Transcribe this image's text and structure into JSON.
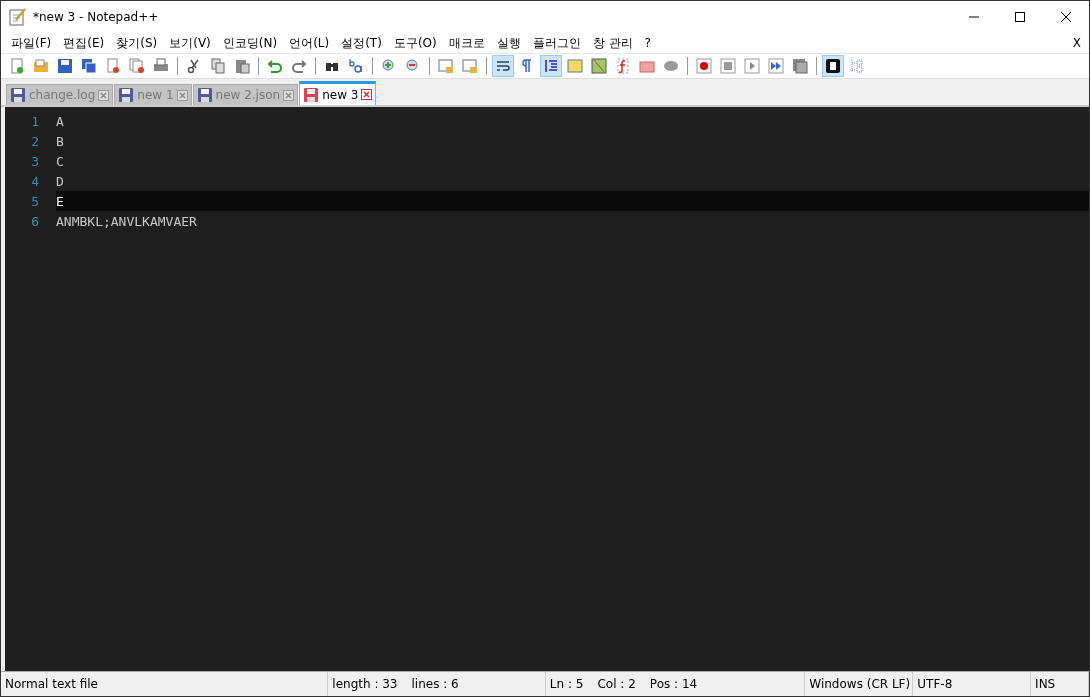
{
  "window": {
    "title": "*new 3 - Notepad++"
  },
  "menu": {
    "items": [
      "파일(F)",
      "편집(E)",
      "찾기(S)",
      "보기(V)",
      "인코딩(N)",
      "언어(L)",
      "설정(T)",
      "도구(O)",
      "매크로",
      "실행",
      "플러그인",
      "창 관리",
      "?"
    ],
    "close_label": "X"
  },
  "toolbar": {
    "groups": [
      [
        {
          "pressed": false
        },
        {
          "pressed": false
        },
        {
          "pressed": false
        },
        {
          "pressed": false
        },
        {
          "pressed": false
        },
        {
          "pressed": false
        },
        {
          "pressed": false
        }
      ],
      [
        {
          "pressed": false
        },
        {
          "pressed": false
        },
        {
          "pressed": false
        }
      ],
      [
        {
          "pressed": false
        },
        {
          "pressed": false
        }
      ],
      [
        {
          "pressed": false
        },
        {
          "pressed": false
        }
      ],
      [
        {
          "pressed": false
        },
        {
          "pressed": false
        }
      ],
      [
        {
          "pressed": false
        },
        {
          "pressed": false
        }
      ],
      [
        {
          "pressed": true
        },
        {
          "pressed": false
        },
        {
          "pressed": true
        },
        {
          "pressed": false
        },
        {
          "pressed": false
        },
        {
          "pressed": false
        },
        {
          "pressed": false
        },
        {
          "pressed": false
        }
      ],
      [
        {
          "pressed": false
        },
        {
          "pressed": false
        },
        {
          "pressed": false
        },
        {
          "pressed": false
        },
        {
          "pressed": false
        }
      ],
      [
        {
          "pressed": true
        },
        {
          "pressed": false
        }
      ]
    ]
  },
  "tabs": [
    {
      "label": "change.log",
      "selected": false,
      "modified": false
    },
    {
      "label": "new 1",
      "selected": false,
      "modified": false
    },
    {
      "label": "new 2.json",
      "selected": false,
      "modified": false
    },
    {
      "label": "new 3",
      "selected": true,
      "modified": true
    }
  ],
  "editor": {
    "lines": [
      {
        "number": "1",
        "text": "A",
        "current": false
      },
      {
        "number": "2",
        "text": "B",
        "current": false
      },
      {
        "number": "3",
        "text": "C",
        "current": false
      },
      {
        "number": "4",
        "text": "D",
        "current": false
      },
      {
        "number": "5",
        "text": "E",
        "current": true
      },
      {
        "number": "6",
        "text": "ANMBKL;ANVLKAMVAER",
        "current": false
      }
    ]
  },
  "status_bar": {
    "sections": [
      [
        "Normal text file"
      ],
      [
        "length : 33",
        "lines : 6"
      ],
      [
        "Ln : 5",
        "Col : 2",
        "Pos : 14"
      ],
      [
        "Windows (CR LF)"
      ],
      [
        "UTF-8"
      ],
      [
        "INS"
      ]
    ]
  }
}
